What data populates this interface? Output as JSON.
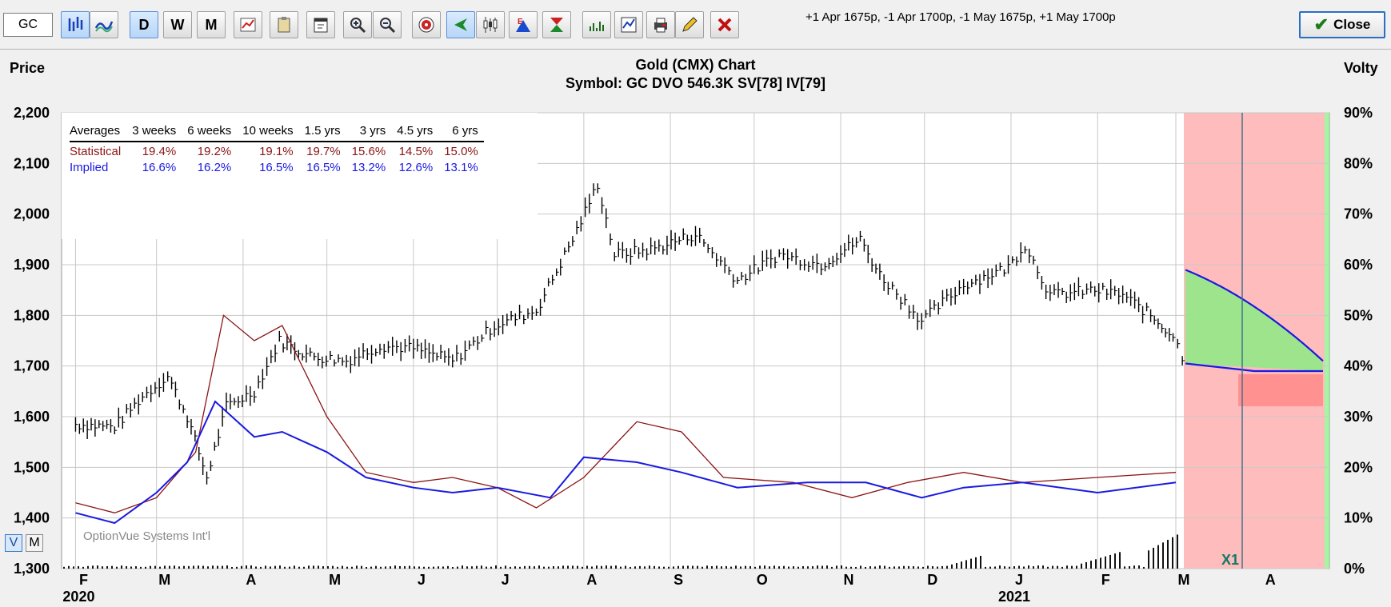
{
  "toolbar": {
    "symbol_value": "GC",
    "buttons": [
      {
        "name": "bar-chart-style-button",
        "icon": "bars-icon",
        "label": "",
        "active": true
      },
      {
        "name": "line-chart-style-button",
        "icon": "wave-icon",
        "label": "",
        "active": false
      },
      {
        "name": "daily-button",
        "icon": "",
        "label": "D",
        "active": true
      },
      {
        "name": "weekly-button",
        "icon": "",
        "label": "W",
        "active": false
      },
      {
        "name": "monthly-button",
        "icon": "",
        "label": "M",
        "active": false
      },
      {
        "name": "chart-options-button",
        "icon": "chart-settings-icon",
        "label": "",
        "active": false
      },
      {
        "name": "paste-button",
        "icon": "clipboard-icon",
        "label": "",
        "active": false
      },
      {
        "name": "calendar-button",
        "icon": "calendar-icon",
        "label": "",
        "active": false
      },
      {
        "name": "zoom-in-button",
        "icon": "zoom-in-icon",
        "label": "",
        "active": false
      },
      {
        "name": "zoom-out-button",
        "icon": "zoom-out-icon",
        "label": "",
        "active": false
      },
      {
        "name": "target-button",
        "icon": "target-icon",
        "label": "",
        "active": false
      },
      {
        "name": "scroll-back-button",
        "icon": "arrow-left-icon",
        "label": "",
        "active": true
      },
      {
        "name": "candles-button",
        "icon": "candles-icon",
        "label": "",
        "active": false
      },
      {
        "name": "earnings-button",
        "icon": "earnings-icon",
        "label": "",
        "active": false
      },
      {
        "name": "dividend-button",
        "icon": "hourglass-icon",
        "label": "",
        "active": false
      },
      {
        "name": "volume-study-button",
        "icon": "volume-icon",
        "label": "",
        "active": false
      },
      {
        "name": "study-chart-button",
        "icon": "study-icon",
        "label": "",
        "active": false
      },
      {
        "name": "print-button",
        "icon": "printer-icon",
        "label": "",
        "active": false
      },
      {
        "name": "draw-button",
        "icon": "pencil-icon",
        "label": "",
        "active": false
      },
      {
        "name": "delete-button",
        "icon": "x-icon",
        "label": "",
        "active": false
      }
    ],
    "order_summary": "+1 Apr 1675p, -1 Apr 1700p, -1 May 1675p, +1 May 1700p",
    "close_label": "Close"
  },
  "chart": {
    "title": "Gold (CMX) Chart",
    "subtitle": "Symbol: GC  DVO 546.3K  SV[78]  IV[79]",
    "left_axis_title": "Price",
    "right_axis_title": "Volty",
    "watermark": "OptionVue Systems Int'l",
    "marker_label": "X1",
    "view_toggle": [
      "V",
      "M"
    ]
  },
  "averages_table": {
    "headers": [
      "Averages",
      "3 weeks",
      "6 weeks",
      "10 weeks",
      "1.5 yrs",
      "3 yrs",
      "4.5 yrs",
      "6 yrs"
    ],
    "rows": [
      {
        "label": "Statistical",
        "values": [
          "19.4%",
          "19.2%",
          "19.1%",
          "19.7%",
          "15.6%",
          "14.5%",
          "15.0%"
        ]
      },
      {
        "label": "Implied",
        "values": [
          "16.6%",
          "16.2%",
          "16.5%",
          "16.5%",
          "13.2%",
          "12.6%",
          "13.1%"
        ]
      }
    ]
  },
  "colors": {
    "price_bars": "#000000",
    "statistical": "#8b1414",
    "implied": "#1a1ae0",
    "profit_zone": "#7ef27e",
    "loss_zone": "#ff9a9a",
    "forecast_bg": "#ffbcbc"
  },
  "chart_data": {
    "type": "line",
    "price_axis": {
      "ylim": [
        1300,
        2200
      ],
      "ticks": [
        "1,300",
        "1,400",
        "1,500",
        "1,600",
        "1,700",
        "1,800",
        "1,900",
        "2,000",
        "2,100",
        "2,200"
      ]
    },
    "volatility_axis": {
      "ylim": [
        0,
        90
      ],
      "ticks": [
        "0%",
        "10%",
        "20%",
        "30%",
        "40%",
        "50%",
        "60%",
        "70%",
        "80%",
        "90%"
      ]
    },
    "x_ticks": [
      "F",
      "M",
      "A",
      "M",
      "J",
      "J",
      "A",
      "S",
      "O",
      "N",
      "D",
      "J",
      "F",
      "M",
      "A"
    ],
    "year_labels": [
      "2020",
      "2021"
    ],
    "grid": true,
    "price_closes": [
      {
        "x": "2020-02-01",
        "y": 1585
      },
      {
        "x": "2020-02-15",
        "y": 1580
      },
      {
        "x": "2020-02-25",
        "y": 1640
      },
      {
        "x": "2020-03-05",
        "y": 1680
      },
      {
        "x": "2020-03-12",
        "y": 1600
      },
      {
        "x": "2020-03-19",
        "y": 1480
      },
      {
        "x": "2020-03-26",
        "y": 1620
      },
      {
        "x": "2020-04-05",
        "y": 1650
      },
      {
        "x": "2020-04-14",
        "y": 1750
      },
      {
        "x": "2020-04-25",
        "y": 1720
      },
      {
        "x": "2020-05-08",
        "y": 1710
      },
      {
        "x": "2020-05-20",
        "y": 1740
      },
      {
        "x": "2020-06-01",
        "y": 1735
      },
      {
        "x": "2020-06-15",
        "y": 1710
      },
      {
        "x": "2020-06-30",
        "y": 1780
      },
      {
        "x": "2020-07-15",
        "y": 1810
      },
      {
        "x": "2020-07-28",
        "y": 1950
      },
      {
        "x": "2020-08-06",
        "y": 2060
      },
      {
        "x": "2020-08-12",
        "y": 1920
      },
      {
        "x": "2020-08-25",
        "y": 1930
      },
      {
        "x": "2020-09-10",
        "y": 1960
      },
      {
        "x": "2020-09-25",
        "y": 1870
      },
      {
        "x": "2020-10-10",
        "y": 1920
      },
      {
        "x": "2020-10-25",
        "y": 1900
      },
      {
        "x": "2020-11-08",
        "y": 1950
      },
      {
        "x": "2020-11-15",
        "y": 1880
      },
      {
        "x": "2020-11-30",
        "y": 1790
      },
      {
        "x": "2020-12-15",
        "y": 1860
      },
      {
        "x": "2020-12-31",
        "y": 1895
      },
      {
        "x": "2021-01-06",
        "y": 1940
      },
      {
        "x": "2021-01-15",
        "y": 1840
      },
      {
        "x": "2021-01-31",
        "y": 1850
      },
      {
        "x": "2021-02-10",
        "y": 1840
      },
      {
        "x": "2021-02-20",
        "y": 1800
      },
      {
        "x": "2021-02-28",
        "y": 1760
      },
      {
        "x": "2021-03-05",
        "y": 1700
      }
    ],
    "series": [
      {
        "name": "Statistical",
        "values": [
          {
            "x": "2020-02-01",
            "y": 13
          },
          {
            "x": "2020-02-15",
            "y": 11
          },
          {
            "x": "2020-03-01",
            "y": 14
          },
          {
            "x": "2020-03-15",
            "y": 23
          },
          {
            "x": "2020-03-25",
            "y": 50
          },
          {
            "x": "2020-04-05",
            "y": 45
          },
          {
            "x": "2020-04-15",
            "y": 48
          },
          {
            "x": "2020-05-01",
            "y": 30
          },
          {
            "x": "2020-05-15",
            "y": 19
          },
          {
            "x": "2020-06-01",
            "y": 17
          },
          {
            "x": "2020-06-15",
            "y": 18
          },
          {
            "x": "2020-07-01",
            "y": 16
          },
          {
            "x": "2020-07-15",
            "y": 12
          },
          {
            "x": "2020-08-01",
            "y": 18
          },
          {
            "x": "2020-08-20",
            "y": 29
          },
          {
            "x": "2020-09-05",
            "y": 27
          },
          {
            "x": "2020-09-20",
            "y": 18
          },
          {
            "x": "2020-10-15",
            "y": 17
          },
          {
            "x": "2020-11-05",
            "y": 14
          },
          {
            "x": "2020-11-25",
            "y": 17
          },
          {
            "x": "2020-12-15",
            "y": 19
          },
          {
            "x": "2021-01-05",
            "y": 17
          },
          {
            "x": "2021-02-01",
            "y": 18
          },
          {
            "x": "2021-03-01",
            "y": 19
          }
        ]
      },
      {
        "name": "Implied",
        "values": [
          {
            "x": "2020-02-01",
            "y": 11
          },
          {
            "x": "2020-02-15",
            "y": 9
          },
          {
            "x": "2020-03-01",
            "y": 15
          },
          {
            "x": "2020-03-12",
            "y": 21
          },
          {
            "x": "2020-03-22",
            "y": 33
          },
          {
            "x": "2020-04-05",
            "y": 26
          },
          {
            "x": "2020-04-15",
            "y": 27
          },
          {
            "x": "2020-05-01",
            "y": 23
          },
          {
            "x": "2020-05-15",
            "y": 18
          },
          {
            "x": "2020-06-01",
            "y": 16
          },
          {
            "x": "2020-06-15",
            "y": 15
          },
          {
            "x": "2020-07-01",
            "y": 16
          },
          {
            "x": "2020-07-20",
            "y": 14
          },
          {
            "x": "2020-08-01",
            "y": 22
          },
          {
            "x": "2020-08-20",
            "y": 21
          },
          {
            "x": "2020-09-05",
            "y": 19
          },
          {
            "x": "2020-09-25",
            "y": 16
          },
          {
            "x": "2020-10-20",
            "y": 17
          },
          {
            "x": "2020-11-10",
            "y": 17
          },
          {
            "x": "2020-11-30",
            "y": 14
          },
          {
            "x": "2020-12-15",
            "y": 16
          },
          {
            "x": "2021-01-05",
            "y": 17
          },
          {
            "x": "2021-02-01",
            "y": 15
          },
          {
            "x": "2021-03-01",
            "y": 17
          }
        ]
      }
    ],
    "forecast": {
      "implied_upper_start": 1890,
      "implied_upper_end": 1710,
      "implied_lower_start": 1705,
      "implied_lower_end": 1690
    }
  }
}
